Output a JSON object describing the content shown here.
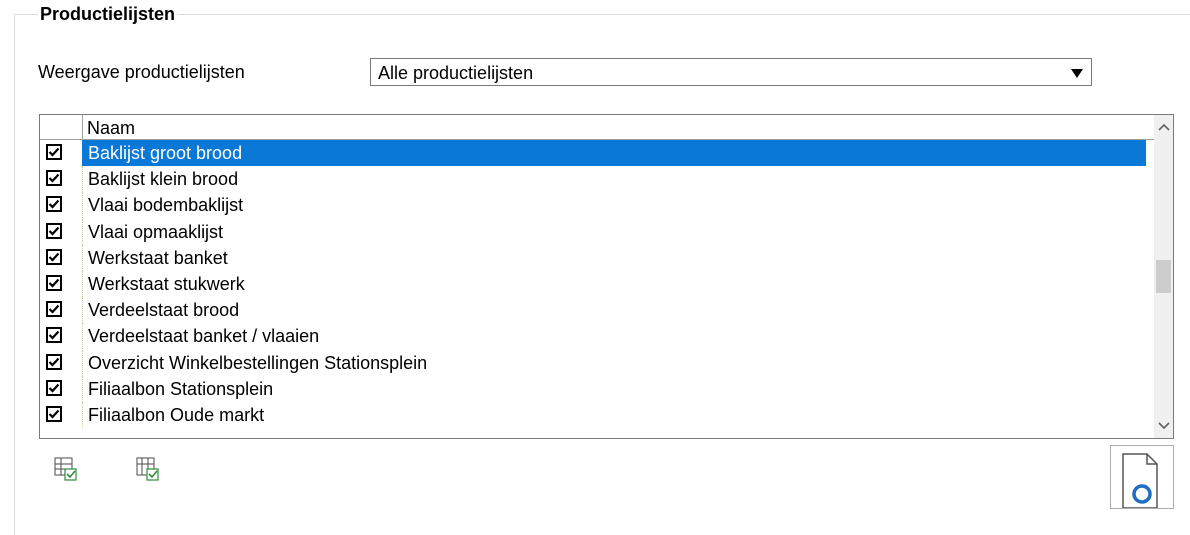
{
  "group": {
    "title": "Productielijsten"
  },
  "view": {
    "label": "Weergave productielijsten",
    "selected": "Alle productielijsten"
  },
  "grid": {
    "column_header": "Naam",
    "rows": [
      {
        "name": "Baklijst groot brood",
        "checked": true,
        "selected": true
      },
      {
        "name": "Baklijst klein brood",
        "checked": true
      },
      {
        "name": "Vlaai bodembaklijst",
        "checked": true
      },
      {
        "name": "Vlaai opmaaklijst",
        "checked": true
      },
      {
        "name": "Werkstaat banket",
        "checked": true
      },
      {
        "name": "Werkstaat stukwerk",
        "checked": true
      },
      {
        "name": "Verdeelstaat brood",
        "checked": true
      },
      {
        "name": "Verdeelstaat banket / vlaaien",
        "checked": true
      },
      {
        "name": "Overzicht Winkelbestellingen Stationsplein",
        "checked": true
      },
      {
        "name": "Filiaalbon Stationsplein",
        "checked": true
      },
      {
        "name": "Filiaalbon Oude markt",
        "checked": true
      }
    ]
  },
  "colors": {
    "selection": "#0a78d7",
    "preview_accent": "#1e6fc4"
  },
  "icons": {
    "toolbar_select_all": "grid-check-all-icon",
    "toolbar_select_column": "grid-check-column-icon",
    "preview": "print-preview-icon",
    "dropdown": "dropdown-arrow-icon"
  }
}
